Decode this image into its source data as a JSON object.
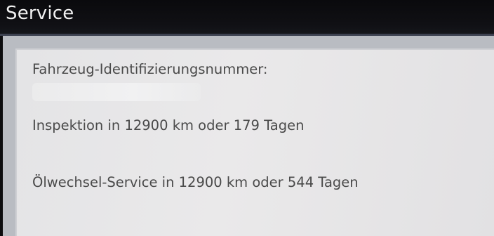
{
  "header": {
    "title": "Service"
  },
  "service_info": {
    "vin_label": "Fahrzeug-Identifizierungsnummer:",
    "vin_value": "",
    "inspection_text": "Inspektion in 12900 km oder 179 Tagen",
    "oil_service_text": "Ölwechsel-Service in 12900 km oder 544 Tagen"
  },
  "colors": {
    "header_bg": "#0c0c0e",
    "panel_bg": "#e8e8e9",
    "text": "#4a4a4a",
    "title_text": "#f2f2f2"
  }
}
